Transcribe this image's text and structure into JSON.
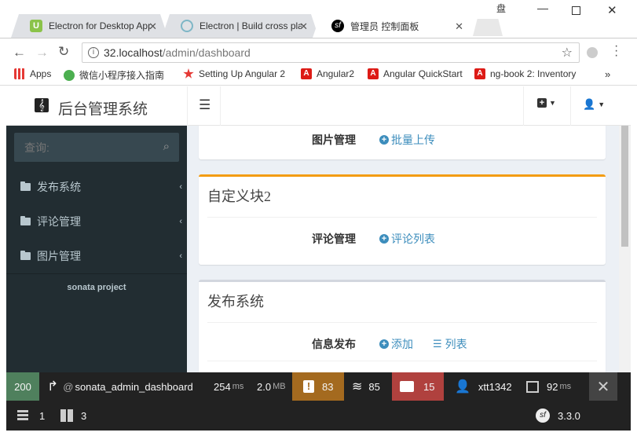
{
  "browser": {
    "tabs": [
      {
        "title": "Electron for Desktop App",
        "active": false,
        "favicon_color": "#8bc34a"
      },
      {
        "title": "Electron | Build cross plat",
        "active": false,
        "favicon_color": "#7eb6c6"
      },
      {
        "title": "管理员 控制面板",
        "active": true,
        "favicon_color": "#000000"
      }
    ],
    "profile_glyph": "盘",
    "url": "32.localhost/admin/dashboard",
    "url_host": "32.localhost",
    "url_path": "/admin/dashboard",
    "bookmarks": [
      {
        "label": "Apps",
        "icon": "apps-icon"
      },
      {
        "label": "微信小程序接入指南",
        "icon": "wechat-icon"
      },
      {
        "label": "Setting Up Angular 2",
        "icon": "bookmark-icon"
      },
      {
        "label": "Angular2",
        "icon": "angular-icon"
      },
      {
        "label": "Angular QuickStart",
        "icon": "angular-icon"
      },
      {
        "label": "ng-book 2: Inventory",
        "icon": "angular-icon"
      }
    ],
    "more_bookmarks": "»"
  },
  "app": {
    "logo_text": "后台管理系统",
    "search_placeholder": "查询:",
    "sidebar_items": [
      {
        "label": "发布系统"
      },
      {
        "label": "评论管理"
      },
      {
        "label": "图片管理"
      }
    ],
    "footer_text": "sonata project",
    "boxes": [
      {
        "title": "",
        "row_label": "图片管理",
        "links": [
          "批量上传"
        ]
      },
      {
        "title": "自定义块2",
        "row_label": "评论管理",
        "links": [
          "评论列表"
        ]
      },
      {
        "title": "发布系统",
        "row_label": "信息发布",
        "links": [
          "添加",
          "列表"
        ]
      }
    ]
  },
  "debugbar": {
    "status": "200",
    "route": "sonata_admin_dashboard",
    "time": "254",
    "time_unit": "ms",
    "memory": "2.0",
    "memory_unit": "MB",
    "logs": "83",
    "cache": "85",
    "translations": "15",
    "user": "xtt1342",
    "render_time": "92",
    "render_unit": "ms",
    "db": "1",
    "forms": "3",
    "version": "3.3.0",
    "colors": {
      "status": "#4f805d",
      "logs": "#a46a1f",
      "translations": "#b0413e"
    }
  }
}
